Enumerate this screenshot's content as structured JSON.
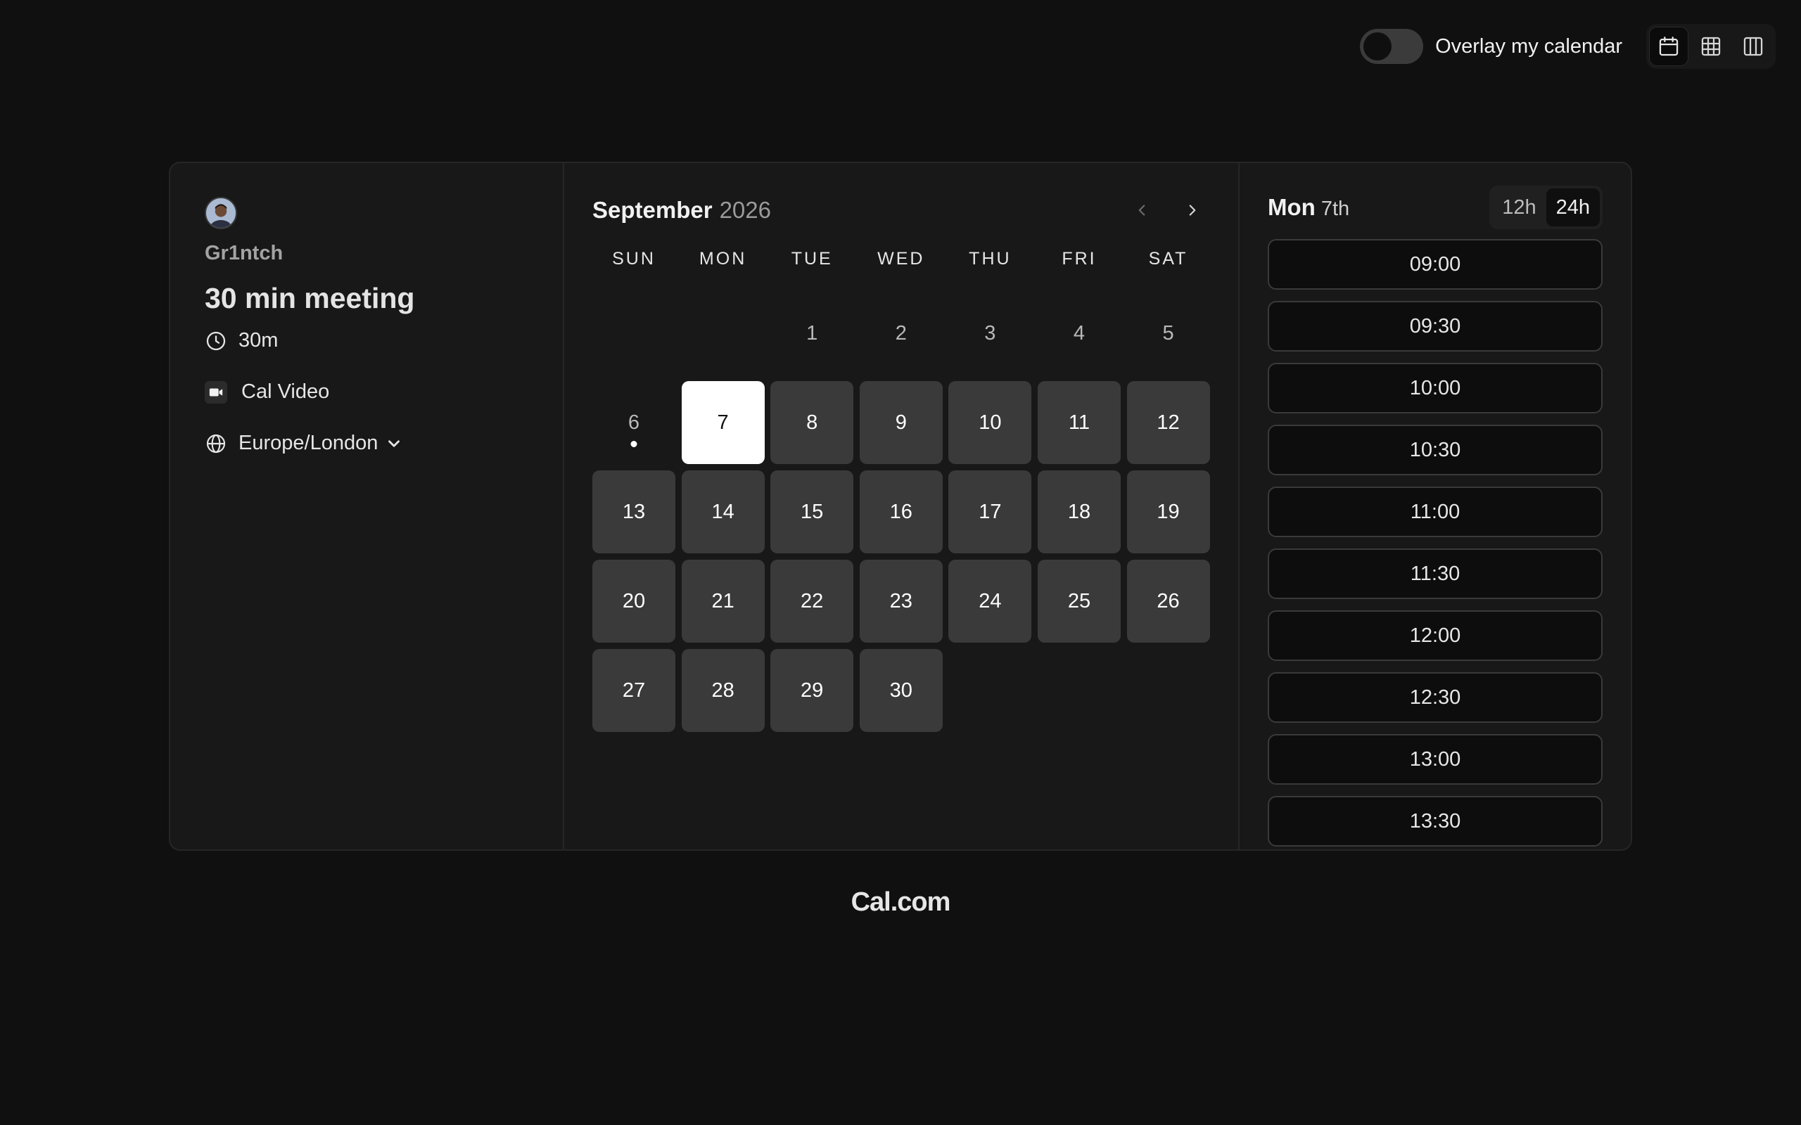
{
  "topbar": {
    "overlay_label": "Overlay my calendar",
    "overlay_enabled": false,
    "views": [
      {
        "icon": "calendar-icon",
        "active": true
      },
      {
        "icon": "grid-icon",
        "active": false
      },
      {
        "icon": "columns-icon",
        "active": false
      }
    ]
  },
  "meta": {
    "host_name": "Gr1ntch",
    "event_title": "30 min meeting",
    "duration": "30m",
    "location": "Cal Video",
    "timezone": "Europe/London"
  },
  "calendar": {
    "month": "September",
    "year": "2026",
    "weekdays": [
      "SUN",
      "MON",
      "TUE",
      "WED",
      "THU",
      "FRI",
      "SAT"
    ],
    "leading_blanks": 2,
    "days": [
      {
        "n": "1",
        "state": "off"
      },
      {
        "n": "2",
        "state": "off"
      },
      {
        "n": "3",
        "state": "off"
      },
      {
        "n": "4",
        "state": "off"
      },
      {
        "n": "5",
        "state": "off"
      },
      {
        "n": "6",
        "state": "today"
      },
      {
        "n": "7",
        "state": "selected"
      },
      {
        "n": "8",
        "state": "avail"
      },
      {
        "n": "9",
        "state": "avail"
      },
      {
        "n": "10",
        "state": "avail"
      },
      {
        "n": "11",
        "state": "avail"
      },
      {
        "n": "12",
        "state": "avail"
      },
      {
        "n": "13",
        "state": "avail"
      },
      {
        "n": "14",
        "state": "avail"
      },
      {
        "n": "15",
        "state": "avail"
      },
      {
        "n": "16",
        "state": "avail"
      },
      {
        "n": "17",
        "state": "avail"
      },
      {
        "n": "18",
        "state": "avail"
      },
      {
        "n": "19",
        "state": "avail"
      },
      {
        "n": "20",
        "state": "avail"
      },
      {
        "n": "21",
        "state": "avail"
      },
      {
        "n": "22",
        "state": "avail"
      },
      {
        "n": "23",
        "state": "avail"
      },
      {
        "n": "24",
        "state": "avail"
      },
      {
        "n": "25",
        "state": "avail"
      },
      {
        "n": "26",
        "state": "avail"
      },
      {
        "n": "27",
        "state": "avail"
      },
      {
        "n": "28",
        "state": "avail"
      },
      {
        "n": "29",
        "state": "avail"
      },
      {
        "n": "30",
        "state": "avail"
      }
    ]
  },
  "slots": {
    "day": "Mon",
    "date": "7th",
    "formats": [
      {
        "label": "12h",
        "active": false
      },
      {
        "label": "24h",
        "active": true
      }
    ],
    "times": [
      "09:00",
      "09:30",
      "10:00",
      "10:30",
      "11:00",
      "11:30",
      "12:00",
      "12:30",
      "13:00",
      "13:30"
    ]
  },
  "footer": {
    "brand": "Cal.com"
  }
}
